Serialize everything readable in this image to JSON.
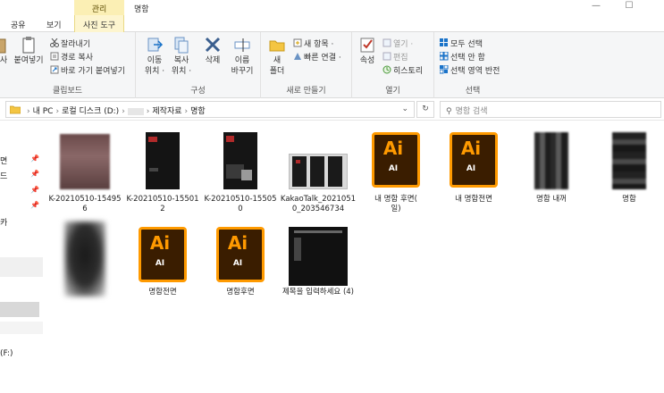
{
  "window": {
    "title": "명함",
    "context_tab_group": "관리",
    "minimize": "—",
    "maximize": "☐"
  },
  "ribbon_tabs": {
    "share": "공유",
    "view": "보기",
    "picture_tools": "사진 도구"
  },
  "ribbon": {
    "clipboard": {
      "paste_partial": "사",
      "paste": "붙여넣기",
      "cut": "잘라내기",
      "copy_path": "경로 복사",
      "paste_shortcut": "바로 가기 붙여넣기",
      "label": "클립보드"
    },
    "organize": {
      "move": "이동",
      "move2": "위치 ·",
      "copy": "복사",
      "copy2": "위치 ·",
      "delete": "삭제",
      "rename": "이름",
      "rename2": "바꾸기",
      "label": "구성"
    },
    "new": {
      "new_folder": "새",
      "new_folder2": "폴더",
      "new_item": "새 항목 ·",
      "easy_access": "빠른 연결 ·",
      "label": "새로 만들기"
    },
    "open": {
      "properties": "속성",
      "open": "열기 ·",
      "edit": "편집",
      "history": "히스토리",
      "label": "열기"
    },
    "select": {
      "select_all": "모두 선택",
      "select_none": "선택 안 함",
      "invert": "선택 영역 반전",
      "label": "선택"
    }
  },
  "address": {
    "this_pc": "내 PC",
    "drive": "로컬 디스크 (D:)",
    "folder1": "제작자료",
    "folder2": "명함",
    "search_placeholder": "명함 검색"
  },
  "nav": {
    "item1": "면",
    "item2": "드",
    "item3": "카",
    "item4": "(F:)"
  },
  "files": [
    {
      "name": "K-20210510-154956"
    },
    {
      "name": "K-20210510-155012"
    },
    {
      "name": "K-20210510-155050"
    },
    {
      "name": "KakaoTalk_20210510_203546734"
    },
    {
      "name": "내 명함 후면(\n일)",
      "ai": "Ai",
      "ai_sub": "AI"
    },
    {
      "name": "내 명함전면",
      "ai": "Ai",
      "ai_sub": "AI"
    },
    {
      "name": "명함 내꺼"
    },
    {
      "name": "명함"
    },
    {
      "name": ""
    },
    {
      "name": "명함전면",
      "ai": "Ai",
      "ai_sub": "AI"
    },
    {
      "name": "명함후면",
      "ai": "Ai",
      "ai_sub": "AI"
    },
    {
      "name": "제목을 입력하세요 (4)"
    }
  ],
  "colors": {
    "ai_orange": "#ff9a00",
    "ai_dark": "#3a1d00",
    "context_tab": "#fbefb4",
    "accent_blue": "#1a73c9"
  }
}
